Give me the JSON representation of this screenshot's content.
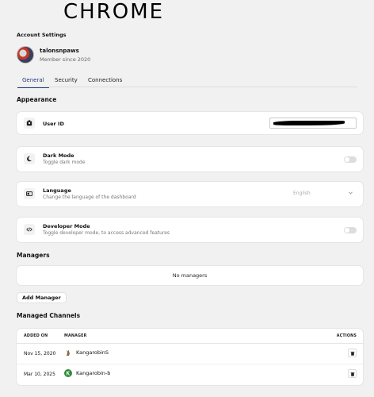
{
  "annotation": "CHROME",
  "page_title": "Account Settings",
  "profile": {
    "username": "talonsnpaws",
    "member_since": "Member since 2020"
  },
  "tabs": [
    {
      "label": "General",
      "active": true
    },
    {
      "label": "Security",
      "active": false
    },
    {
      "label": "Connections",
      "active": false
    }
  ],
  "appearance": {
    "heading": "Appearance",
    "user_id": {
      "label": "User ID",
      "icon": "id-badge-icon",
      "value_redacted": true
    },
    "dark_mode": {
      "label": "Dark Mode",
      "description": "Toggle dark mode",
      "icon": "moon-icon",
      "enabled": false
    },
    "language": {
      "label": "Language",
      "description": "Change the language of the dashboard",
      "icon": "language-icon",
      "selected": "English"
    },
    "developer_mode": {
      "label": "Developer Mode",
      "description": "Toggle developer mode, to access advanced features",
      "icon": "code-icon",
      "enabled": false
    }
  },
  "managers": {
    "heading": "Managers",
    "empty_text": "No managers",
    "add_button": "Add Manager"
  },
  "managed_channels": {
    "heading": "Managed Channels",
    "columns": [
      "ADDED ON",
      "MANAGER",
      "ACTIONS"
    ],
    "rows": [
      {
        "added_on": "Nov 15, 2020",
        "manager": "KangarobinS",
        "avatar": "kangaroo-avatar"
      },
      {
        "added_on": "Mar 10, 2025",
        "manager": "Kangarobin-b",
        "avatar": "green-k-avatar"
      }
    ]
  },
  "colors": {
    "accent": "#1f3d7a",
    "background": "#f1f1f1",
    "card": "#ffffff"
  }
}
